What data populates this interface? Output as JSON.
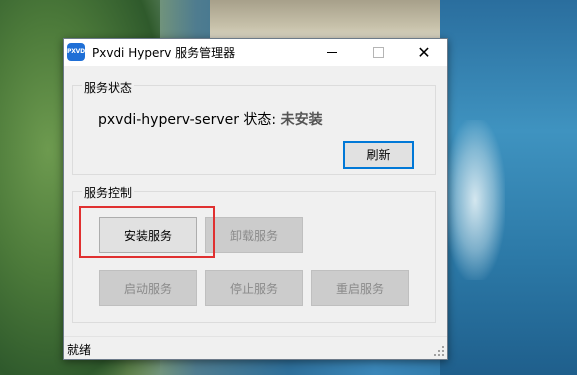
{
  "window": {
    "icon_text": "PXVDI",
    "title": "Pxvdi Hyperv 服务管理器",
    "minimize_icon": "minimize-icon",
    "maximize_icon": "maximize-icon",
    "close_glyph": "✕"
  },
  "status_group": {
    "label": "服务状态",
    "service_line": "pxvdi-hyperv-server 状态:",
    "status_value": "未安装",
    "refresh_label": "刷新"
  },
  "control_group": {
    "label": "服务控制",
    "install_label": "安装服务",
    "uninstall_label": "卸载服务",
    "start_label": "启动服务",
    "stop_label": "停止服务",
    "restart_label": "重启服务"
  },
  "statusbar": {
    "text": "就绪"
  },
  "colors": {
    "highlight": "#e03030",
    "default_button_border": "#0078d7",
    "app_icon": "#1f6fd6"
  }
}
